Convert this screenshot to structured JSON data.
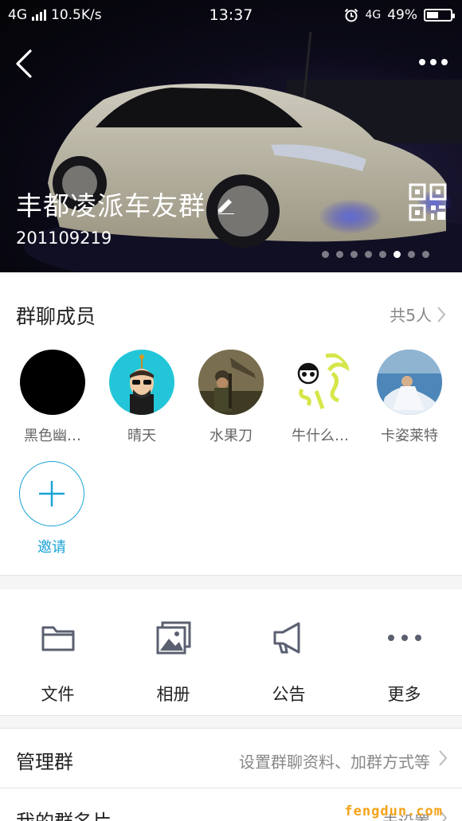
{
  "status_bar": {
    "network_left": "4G",
    "speed": "10.5K/s",
    "time": "13:37",
    "network_right": "4G",
    "battery": "49%",
    "battery_level": 0.49
  },
  "header": {
    "group_name": "丰都凌派车友群",
    "group_id": "201109219",
    "carousel_pages": 8,
    "carousel_active_index": 5
  },
  "members": {
    "title": "群聊成员",
    "count_label": "共5人",
    "list": [
      {
        "name": "黑色幽…",
        "avatar": "black-circle"
      },
      {
        "name": "晴天",
        "avatar": "cartoon-man-cyan"
      },
      {
        "name": "水果刀",
        "avatar": "soldier-photo"
      },
      {
        "name": "牛什么…",
        "avatar": "doodle-face"
      },
      {
        "name": "卡姿莱特",
        "avatar": "bride-photo"
      }
    ],
    "invite_label": "邀请"
  },
  "actions": [
    {
      "label": "文件",
      "icon": "folder-icon"
    },
    {
      "label": "相册",
      "icon": "photo-album-icon"
    },
    {
      "label": "公告",
      "icon": "megaphone-icon"
    },
    {
      "label": "更多",
      "icon": "more-dots-icon"
    }
  ],
  "settings": {
    "manage_group": {
      "label": "管理群",
      "value": "设置群聊资料、加群方式等"
    },
    "my_card": {
      "label": "我的群名片",
      "value": "未设置"
    }
  },
  "watermark": "fengdun.com",
  "colors": {
    "accent": "#1aa3d6",
    "icon_gray": "#5a6070"
  }
}
